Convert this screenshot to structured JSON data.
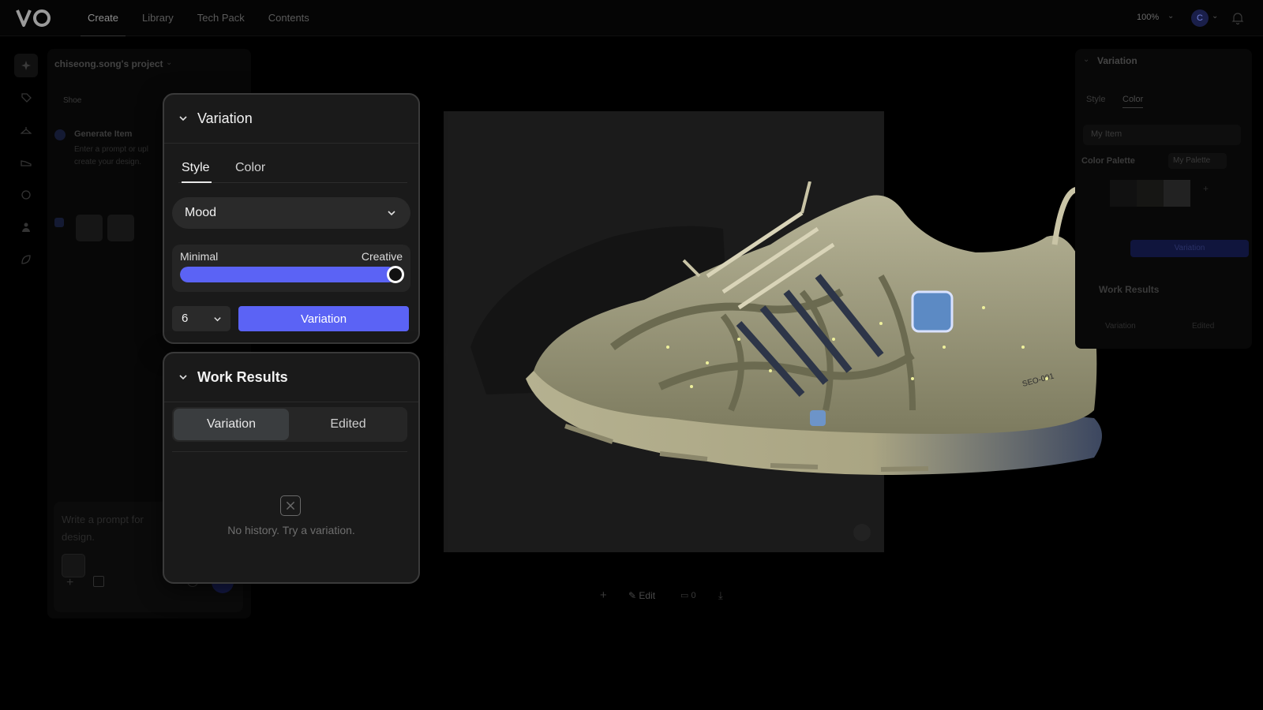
{
  "nav": {
    "tabs": [
      "Create",
      "Library",
      "Tech Pack",
      "Contents"
    ],
    "zoom": "100%",
    "avatar_initial": "C"
  },
  "project": {
    "title": "chiseong.song's project",
    "filter": "Shoe",
    "generate_title": "Generate Item",
    "generate_desc": "Enter a prompt or upl create your design.",
    "prompt_placeholder": "Write a prompt for design."
  },
  "variation_panel": {
    "title": "Variation",
    "tabs": [
      "Style",
      "Color"
    ],
    "active_tab": "Style",
    "mood_select": "Mood",
    "slider": {
      "min_label": "Minimal",
      "max_label": "Creative",
      "value": 1.0
    },
    "count": "6",
    "button": "Variation",
    "accent": "#5b63f5"
  },
  "work_results": {
    "title": "Work Results",
    "tabs": [
      "Variation",
      "Edited"
    ],
    "active_tab": "Variation",
    "empty_text": "No history. Try a variation."
  },
  "canvas_toolbar": {
    "edit_label": "Edit",
    "comments": "0"
  },
  "right_panel": {
    "title": "Variation",
    "tabs": [
      "Style",
      "Color"
    ],
    "select": "My Item",
    "palette_label": "Color Palette",
    "palette_button": "My Palette",
    "button": "Variation",
    "work_results_title": "Work Results",
    "work_results_tabs": [
      "Variation",
      "Edited"
    ]
  },
  "product": {
    "print_label": "SEO-001"
  }
}
